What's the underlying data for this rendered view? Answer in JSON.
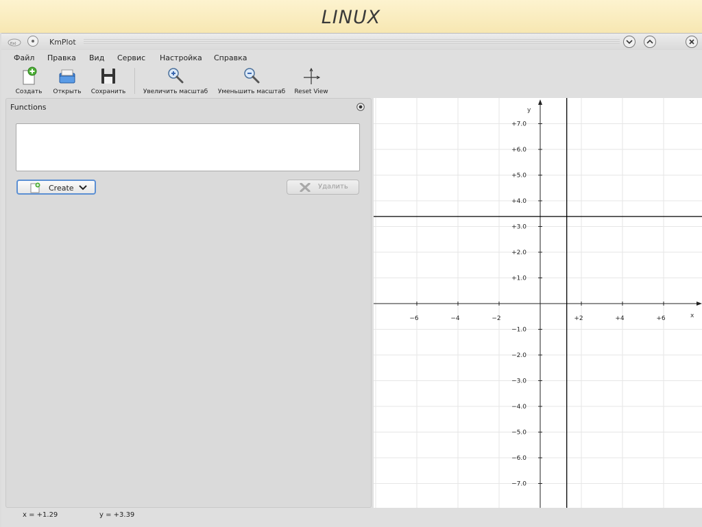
{
  "banner": {
    "text": "LINUX"
  },
  "window": {
    "title": "KmPlot"
  },
  "menu": [
    {
      "label": "Файл"
    },
    {
      "label": "Правка"
    },
    {
      "label": "Вид"
    },
    {
      "label": "Сервис"
    },
    {
      "label": "Настройка"
    },
    {
      "label": "Справка"
    }
  ],
  "toolbar": {
    "new_label": "Создать",
    "open_label": "Открыть",
    "save_label": "Сохранить",
    "zoom_in_label": "Увеличить масштаб",
    "zoom_out_label": "Уменьшить масштаб",
    "reset_view_label": "Reset View"
  },
  "functions_panel": {
    "title": "Functions",
    "create_label": "Create",
    "delete_label": "Удалить"
  },
  "plot": {
    "x_axis_label": "x",
    "y_axis_label": "y",
    "x_ticks": [
      "−6",
      "−4",
      "−2",
      "+2",
      "+4",
      "+6"
    ],
    "y_ticks": [
      "+7.0",
      "+6.0",
      "+5.0",
      "+4.0",
      "+3.0",
      "+2.0",
      "+1.0",
      "−1.0",
      "−2.0",
      "−3.0",
      "−4.0",
      "−5.0",
      "−6.0",
      "−7.0"
    ],
    "crosshair_x": 1.29,
    "crosshair_y": 3.39,
    "colors": {
      "axis": "#222222",
      "grid": "#e6e6e6",
      "crosshair": "#000000"
    }
  },
  "status": {
    "x_readout": "x = +1.29",
    "y_readout": "y = +3.39"
  }
}
